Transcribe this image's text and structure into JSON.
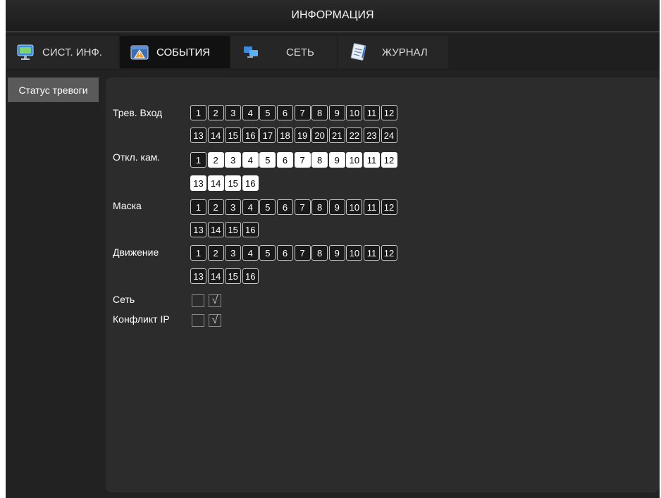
{
  "window": {
    "title": "ИНФОРМАЦИЯ"
  },
  "tabs": [
    {
      "label": "СИСТ. ИНФ.",
      "icon": "monitor-icon",
      "active": false
    },
    {
      "label": "СОБЫТИЯ",
      "icon": "warning-icon",
      "active": true
    },
    {
      "label": "СЕТЬ",
      "icon": "network-icon",
      "active": false
    },
    {
      "label": "ЖУРНАЛ",
      "icon": "log-icon",
      "active": false
    }
  ],
  "sidebar": {
    "item": "Статус тревоги"
  },
  "rows": {
    "alarm_in": {
      "label": "Трев. Вход",
      "channels": [
        "1",
        "2",
        "3",
        "4",
        "5",
        "6",
        "7",
        "8",
        "9",
        "10",
        "11",
        "12",
        "13",
        "14",
        "15",
        "16",
        "17",
        "18",
        "19",
        "20",
        "21",
        "22",
        "23",
        "24"
      ]
    },
    "video_loss": {
      "label": "Откл. кам.",
      "channels": [
        "1",
        "2",
        "3",
        "4",
        "5",
        "6",
        "7",
        "8",
        "9",
        "10",
        "11",
        "12",
        "13",
        "14",
        "15",
        "16"
      ]
    },
    "mask": {
      "label": "Маска",
      "channels": [
        "1",
        "2",
        "3",
        "4",
        "5",
        "6",
        "7",
        "8",
        "9",
        "10",
        "11",
        "12",
        "13",
        "14",
        "15",
        "16"
      ]
    },
    "motion": {
      "label": "Движение",
      "channels": [
        "1",
        "2",
        "3",
        "4",
        "5",
        "6",
        "7",
        "8",
        "9",
        "10",
        "11",
        "12",
        "13",
        "14",
        "15",
        "16"
      ]
    },
    "network": {
      "label": "Сеть",
      "check_mark": "√"
    },
    "ip_conflict": {
      "label": "Конфликт IP",
      "check_mark": "√"
    }
  },
  "colors": {
    "active_channel": "#ffffff",
    "inactive_channel": "#1a1a1a",
    "panel": "#2c2c2c"
  }
}
